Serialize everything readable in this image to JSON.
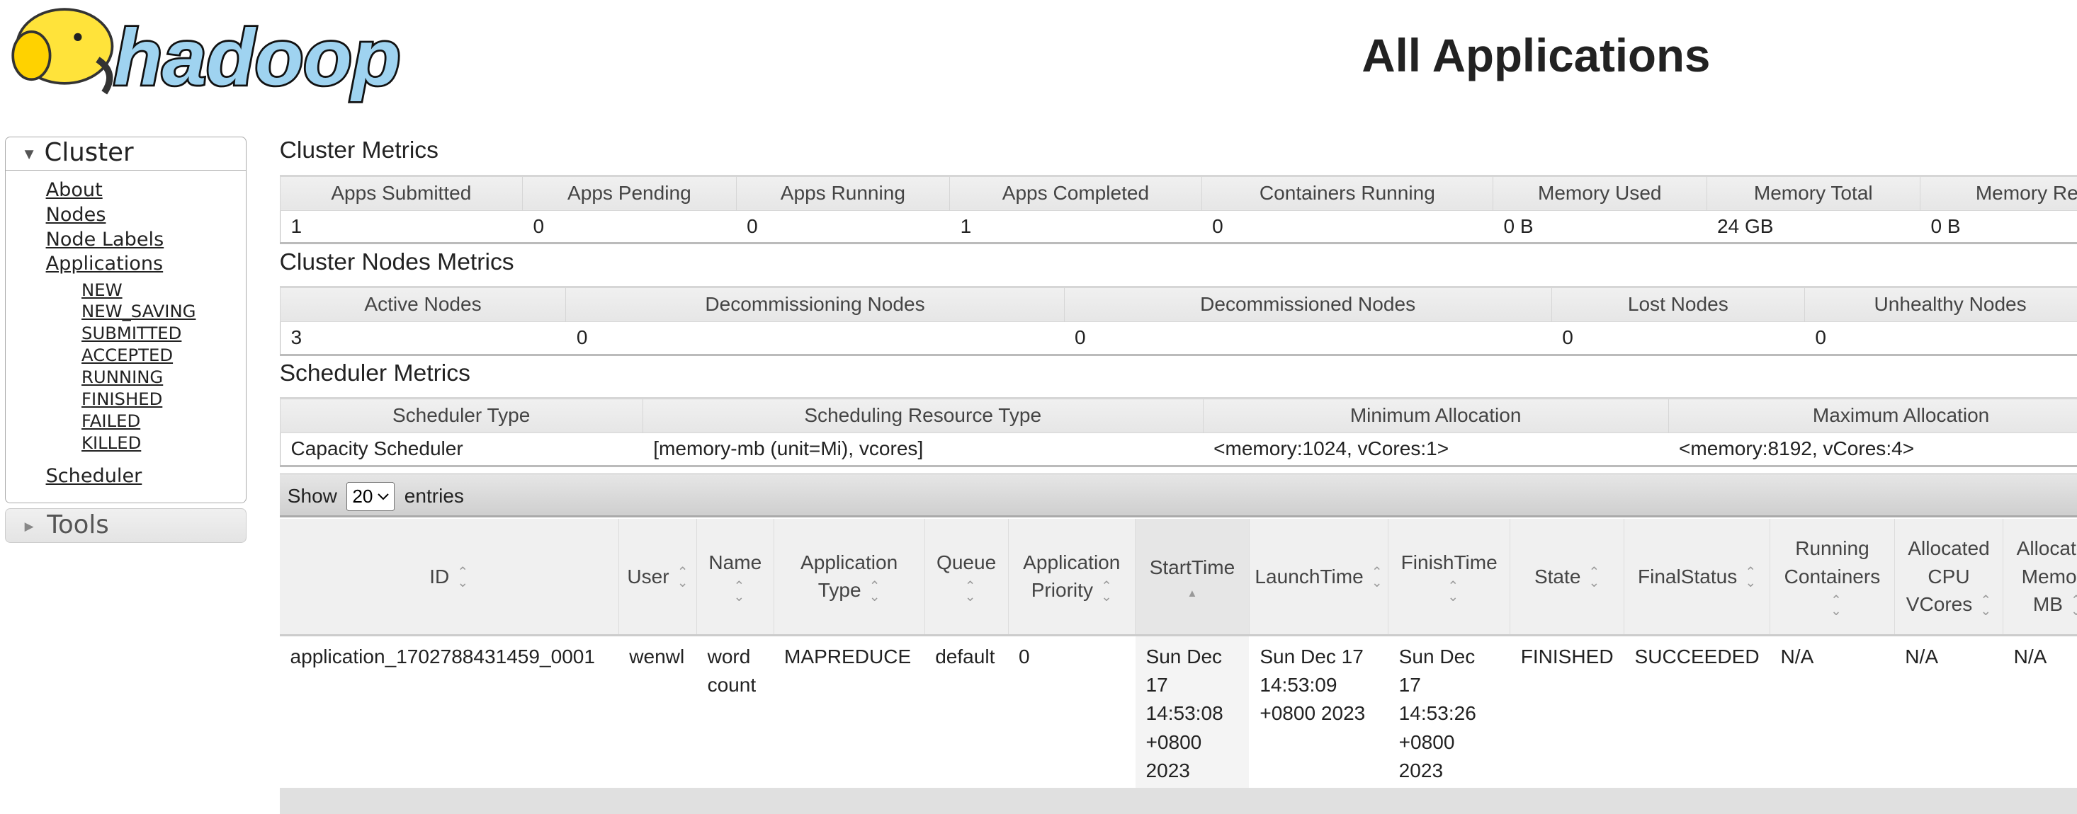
{
  "logo_text": "hadoop",
  "page_title": "All Applications",
  "nav": {
    "cluster_label": "Cluster",
    "links": [
      "About",
      "Nodes",
      "Node Labels",
      "Applications"
    ],
    "app_states": [
      "NEW",
      "NEW_SAVING",
      "SUBMITTED",
      "ACCEPTED",
      "RUNNING",
      "FINISHED",
      "FAILED",
      "KILLED"
    ],
    "scheduler": "Scheduler",
    "tools_label": "Tools"
  },
  "cluster_metrics": {
    "title": "Cluster Metrics",
    "headers": [
      "Apps Submitted",
      "Apps Pending",
      "Apps Running",
      "Apps Completed",
      "Containers Running",
      "Memory Used",
      "Memory Total",
      "Memory Re"
    ],
    "values": [
      "1",
      "0",
      "0",
      "1",
      "0",
      "0 B",
      "24 GB",
      "0 B"
    ]
  },
  "nodes_metrics": {
    "title": "Cluster Nodes Metrics",
    "headers": [
      "Active Nodes",
      "Decommissioning Nodes",
      "Decommissioned Nodes",
      "Lost Nodes",
      "Unhealthy Nodes"
    ],
    "values": [
      "3",
      "0",
      "0",
      "0",
      "0"
    ]
  },
  "scheduler_metrics": {
    "title": "Scheduler Metrics",
    "headers": [
      "Scheduler Type",
      "Scheduling Resource Type",
      "Minimum Allocation",
      "Maximum Allocation"
    ],
    "values": [
      "Capacity Scheduler",
      "[memory-mb (unit=Mi), vcores]",
      "<memory:1024, vCores:1>",
      "<memory:8192, vCores:4>"
    ]
  },
  "entries": {
    "show": "Show",
    "value": "20",
    "suffix": "entries"
  },
  "apps_table": {
    "headers": [
      "ID",
      "User",
      "Name",
      "Application Type",
      "Queue",
      "Application Priority",
      "StartTime",
      "LaunchTime",
      "FinishTime",
      "State",
      "FinalStatus",
      "Running Containers",
      "Allocated CPU VCores",
      "Allocated Memory MB"
    ],
    "sorted_column": "StartTime",
    "rows": [
      [
        "application_1702788431459_0001",
        "wenwl",
        "word count",
        "MAPREDUCE",
        "default",
        "0",
        "Sun Dec 17 14:53:08 +0800 2023",
        "Sun Dec 17 14:53:09 +0800 2023",
        "Sun Dec 17 14:53:26 +0800 2023",
        "FINISHED",
        "SUCCEEDED",
        "N/A",
        "N/A",
        "N/A"
      ]
    ]
  }
}
